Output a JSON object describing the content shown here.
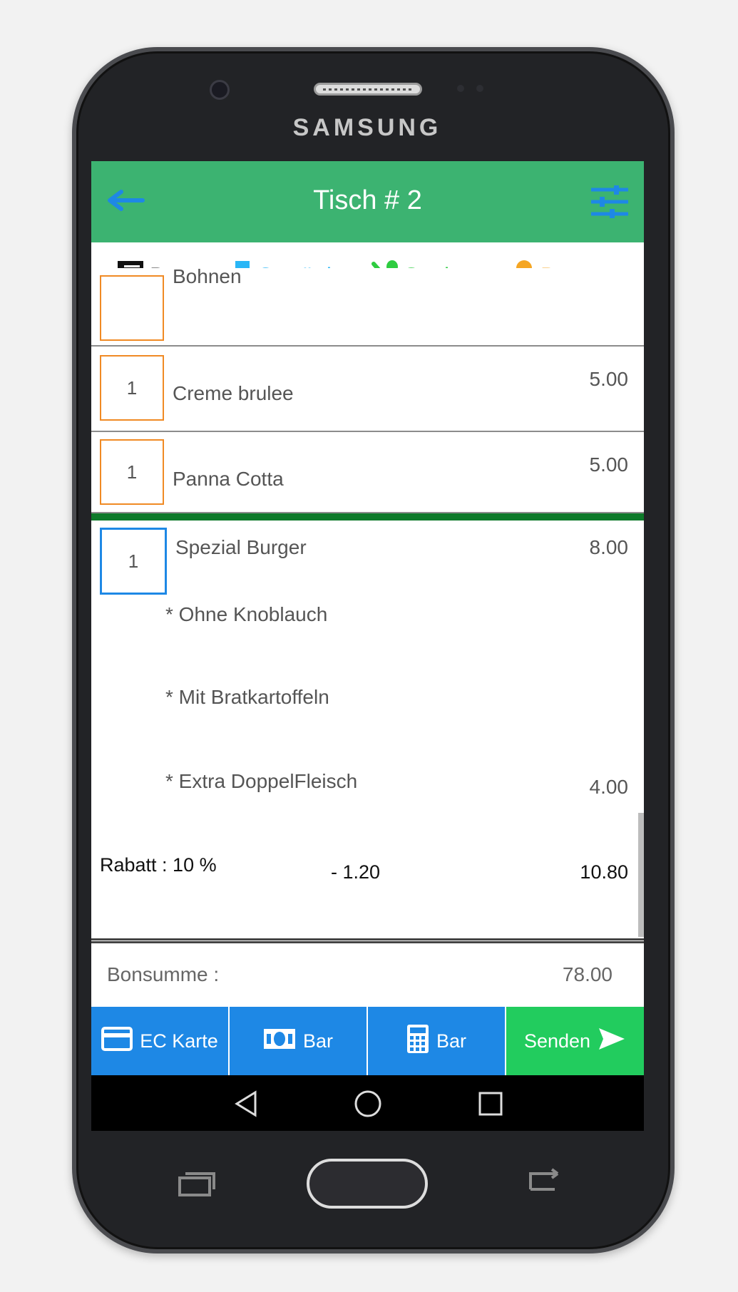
{
  "device": {
    "brand": "SAMSUNG"
  },
  "appbar": {
    "title": "Tisch # 2",
    "back_icon": "arrow-left-icon",
    "filter_icon": "sliders-icon"
  },
  "tabs": [
    {
      "label": "Bon",
      "icon": "receipt-icon",
      "color": "#111111",
      "active": true
    },
    {
      "label": "Getränke",
      "icon": "wine-glass-icon",
      "color": "#29b6f6"
    },
    {
      "label": "Speisen",
      "icon": "fork-spoon-icon",
      "color": "#2ecc40"
    },
    {
      "label": "Dessert",
      "icon": "ice-cream-icon",
      "color": "#f5a623"
    }
  ],
  "order": {
    "partial_item": "Bohnen",
    "items": [
      {
        "qty": "1",
        "name": "Creme brulee",
        "price": "5.00"
      },
      {
        "qty": "1",
        "name": "Panna Cotta",
        "price": "5.00"
      }
    ],
    "selected_item": {
      "qty": "1",
      "name": "Spezial Burger",
      "price": "8.00",
      "options": [
        "* Ohne Knoblauch",
        "* Mit  Bratkartoffeln",
        "* Extra  DoppelFleisch"
      ],
      "option_price": "4.00",
      "discount_label": "Rabatt : 10 %",
      "discount_value": "- 1.20",
      "total": "10.80"
    }
  },
  "summary": {
    "label": "Bonsumme  :",
    "value": "78.00"
  },
  "actions": {
    "ec_card": "EC Karte",
    "cash": "Bar",
    "calc_cash": "Bar",
    "send": "Senden"
  },
  "colors": {
    "appbar": "#3cb371",
    "action_blue": "#1e88e5",
    "action_green": "#22cc5e",
    "qty_border": "#f08a24"
  }
}
